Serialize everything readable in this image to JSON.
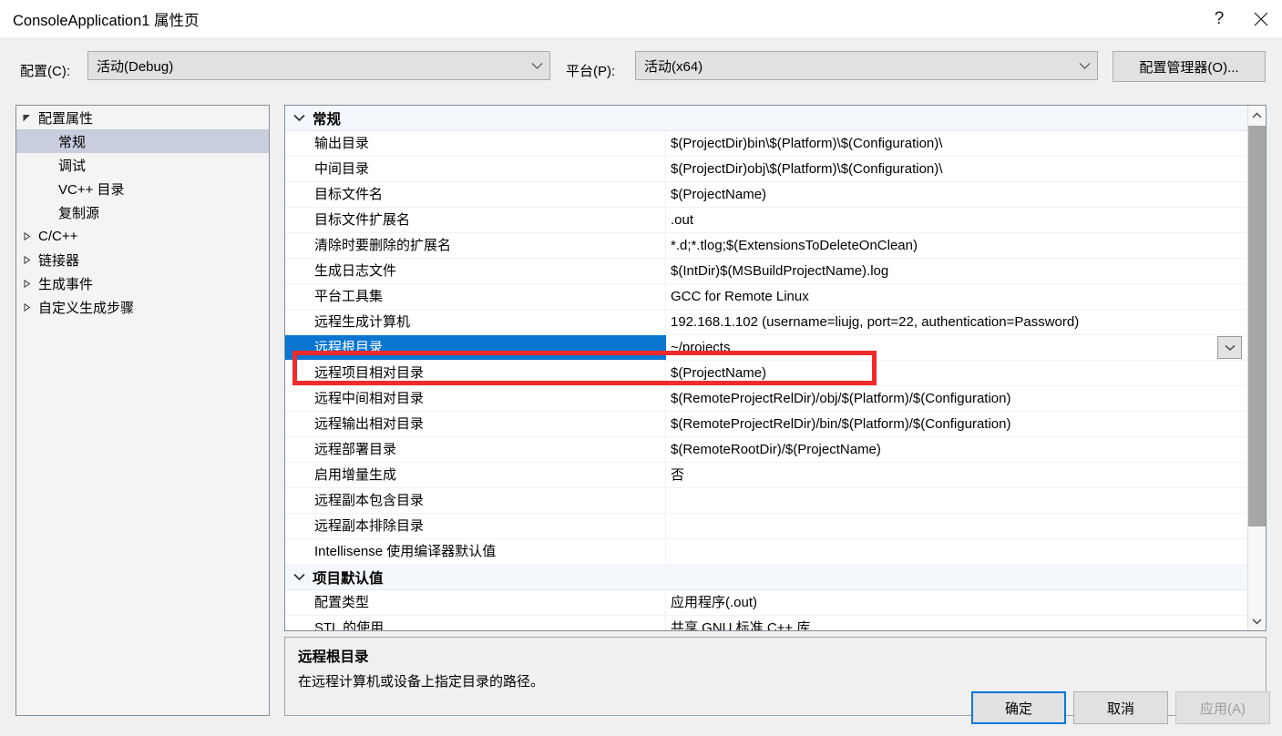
{
  "window": {
    "title": "ConsoleApplication1 属性页",
    "help_icon": "help-icon",
    "close_icon": "close-icon"
  },
  "config_bar": {
    "configuration_label": "配置(C):",
    "configuration_value": "活动(Debug)",
    "platform_label": "平台(P):",
    "platform_value": "活动(x64)",
    "configuration_manager_button": "配置管理器(O)..."
  },
  "tree": {
    "items": [
      {
        "label": "配置属性",
        "depth": 0,
        "twisty": "expanded",
        "selected": false
      },
      {
        "label": "常规",
        "depth": 1,
        "twisty": "none",
        "selected": true
      },
      {
        "label": "调试",
        "depth": 1,
        "twisty": "none",
        "selected": false
      },
      {
        "label": "VC++ 目录",
        "depth": 1,
        "twisty": "none",
        "selected": false
      },
      {
        "label": "复制源",
        "depth": 1,
        "twisty": "none",
        "selected": false
      },
      {
        "label": "C/C++",
        "depth": 0,
        "twisty": "collapsed",
        "selected": false
      },
      {
        "label": "链接器",
        "depth": 0,
        "twisty": "collapsed",
        "selected": false
      },
      {
        "label": "生成事件",
        "depth": 0,
        "twisty": "collapsed",
        "selected": false
      },
      {
        "label": "自定义生成步骤",
        "depth": 0,
        "twisty": "collapsed",
        "selected": false
      }
    ]
  },
  "property_grid": {
    "rows": [
      {
        "type": "group",
        "name": "常规"
      },
      {
        "type": "prop",
        "name": "输出目录",
        "value": "$(ProjectDir)bin\\$(Platform)\\$(Configuration)\\"
      },
      {
        "type": "prop",
        "name": "中间目录",
        "value": "$(ProjectDir)obj\\$(Platform)\\$(Configuration)\\"
      },
      {
        "type": "prop",
        "name": "目标文件名",
        "value": "$(ProjectName)"
      },
      {
        "type": "prop",
        "name": "目标文件扩展名",
        "value": ".out"
      },
      {
        "type": "prop",
        "name": "清除时要删除的扩展名",
        "value": "*.d;*.tlog;$(ExtensionsToDeleteOnClean)"
      },
      {
        "type": "prop",
        "name": "生成日志文件",
        "value": "$(IntDir)$(MSBuildProjectName).log"
      },
      {
        "type": "prop",
        "name": "平台工具集",
        "value": "GCC for Remote Linux"
      },
      {
        "type": "prop",
        "name": "远程生成计算机",
        "value": "192.168.1.102 (username=liujg, port=22, authentication=Password)"
      },
      {
        "type": "prop",
        "name": "远程根目录",
        "value": "~/projects",
        "selected": true
      },
      {
        "type": "prop",
        "name": "远程项目相对目录",
        "value": "$(ProjectName)"
      },
      {
        "type": "prop",
        "name": "远程中间相对目录",
        "value": "$(RemoteProjectRelDir)/obj/$(Platform)/$(Configuration)"
      },
      {
        "type": "prop",
        "name": "远程输出相对目录",
        "value": "$(RemoteProjectRelDir)/bin/$(Platform)/$(Configuration)"
      },
      {
        "type": "prop",
        "name": "远程部署目录",
        "value": "$(RemoteRootDir)/$(ProjectName)"
      },
      {
        "type": "prop",
        "name": "启用增量生成",
        "value": "否"
      },
      {
        "type": "prop",
        "name": "远程副本包含目录",
        "value": ""
      },
      {
        "type": "prop",
        "name": "远程副本排除目录",
        "value": ""
      },
      {
        "type": "prop",
        "name": "Intellisense 使用编译器默认值",
        "value": ""
      },
      {
        "type": "group",
        "name": "项目默认值"
      },
      {
        "type": "prop",
        "name": "配置类型",
        "value": "应用程序(.out)"
      },
      {
        "type": "prop",
        "name": "STL 的使用",
        "value": "共享 GNU 标准 C++ 库"
      }
    ],
    "row_dropdown_icon": "chevron-down-icon"
  },
  "description": {
    "title": "远程根目录",
    "text": "在远程计算机或设备上指定目录的路径。"
  },
  "footer": {
    "ok": "确定",
    "cancel": "取消",
    "apply": "应用(A)"
  },
  "colors": {
    "selection_blue": "#0a76d1",
    "annotation_red": "#f32a2a",
    "default_button_border": "#0078d7",
    "dialog_background": "#f0f0f0"
  }
}
